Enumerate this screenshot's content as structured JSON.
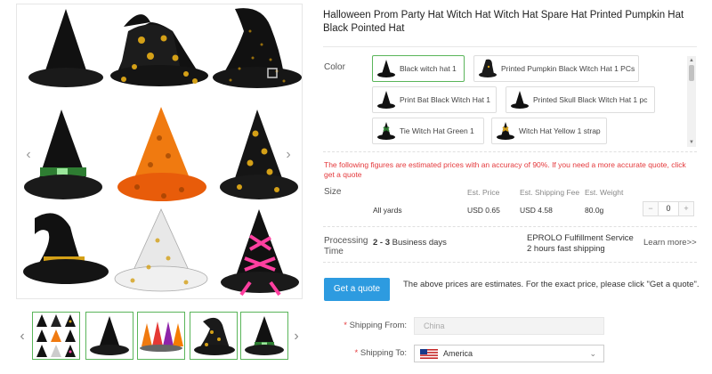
{
  "product": {
    "title": "Halloween Prom Party Hat Witch Hat Witch Hat Spare Hat Printed Pumpkin Hat Black Pointed Hat"
  },
  "gallery": {
    "prev_icon": "chevron-left-icon",
    "next_icon": "chevron-right-icon",
    "thumbnails": [
      {
        "name": "thumb-witch-hat-set"
      },
      {
        "name": "thumb-black-witch-hat"
      },
      {
        "name": "thumb-colored-witch-hats"
      },
      {
        "name": "thumb-pumpkin-witch-hat"
      },
      {
        "name": "thumb-green-buckle-witch-hat"
      }
    ]
  },
  "color": {
    "label": "Color",
    "options": [
      {
        "label": "Black witch hat 1",
        "selected": true,
        "hat_color": "#111111"
      },
      {
        "label": "Printed Pumpkin Black Witch Hat 1 PCs",
        "selected": false,
        "hat_color": "#1a1a1a"
      },
      {
        "label": "Print Bat Black Witch Hat 1",
        "selected": false,
        "hat_color": "#111111"
      },
      {
        "label": "Printed Skull Black Witch Hat 1 pc",
        "selected": false,
        "hat_color": "#111111"
      },
      {
        "label": "Tie Witch Hat Green 1",
        "selected": false,
        "hat_color": "#2e7d32"
      },
      {
        "label": "Witch Hat Yellow 1 strap",
        "selected": false,
        "hat_color": "#d4a017"
      }
    ]
  },
  "notice": {
    "text": "The following figures are estimated prices with an accuracy of 90%. If you need a more accurate quote, click get a quote"
  },
  "pricing": {
    "size_label": "Size",
    "headers": {
      "price": "Est. Price",
      "shipping": "Est. Shipping Fee",
      "weight": "Est. Weight"
    },
    "row": {
      "size": "All yards",
      "price": "USD 0.65",
      "shipping": "USD 4.58",
      "weight": "80.0g"
    },
    "quantity": {
      "minus": "−",
      "value": "0",
      "plus": "+"
    }
  },
  "processing": {
    "label": "Processing Time",
    "days_range": "2 - 3",
    "days_unit": " Business days",
    "service_line1": "EPROLO Fulfillment Service",
    "service_line2": "2 hours fast shipping",
    "learn_more": "Learn more>>"
  },
  "quote": {
    "button": "Get a quote",
    "note": "The above prices are estimates. For the exact price, please click \"Get a quote\"."
  },
  "shipping": {
    "from_label": "Shipping From:",
    "from_value": "China",
    "to_label": "Shipping To:",
    "to_value": "America",
    "required_mark": "*"
  },
  "colors": {
    "accent_green": "#5ab55a",
    "button_blue": "#2d9be0",
    "notice_red": "#e4393c"
  }
}
